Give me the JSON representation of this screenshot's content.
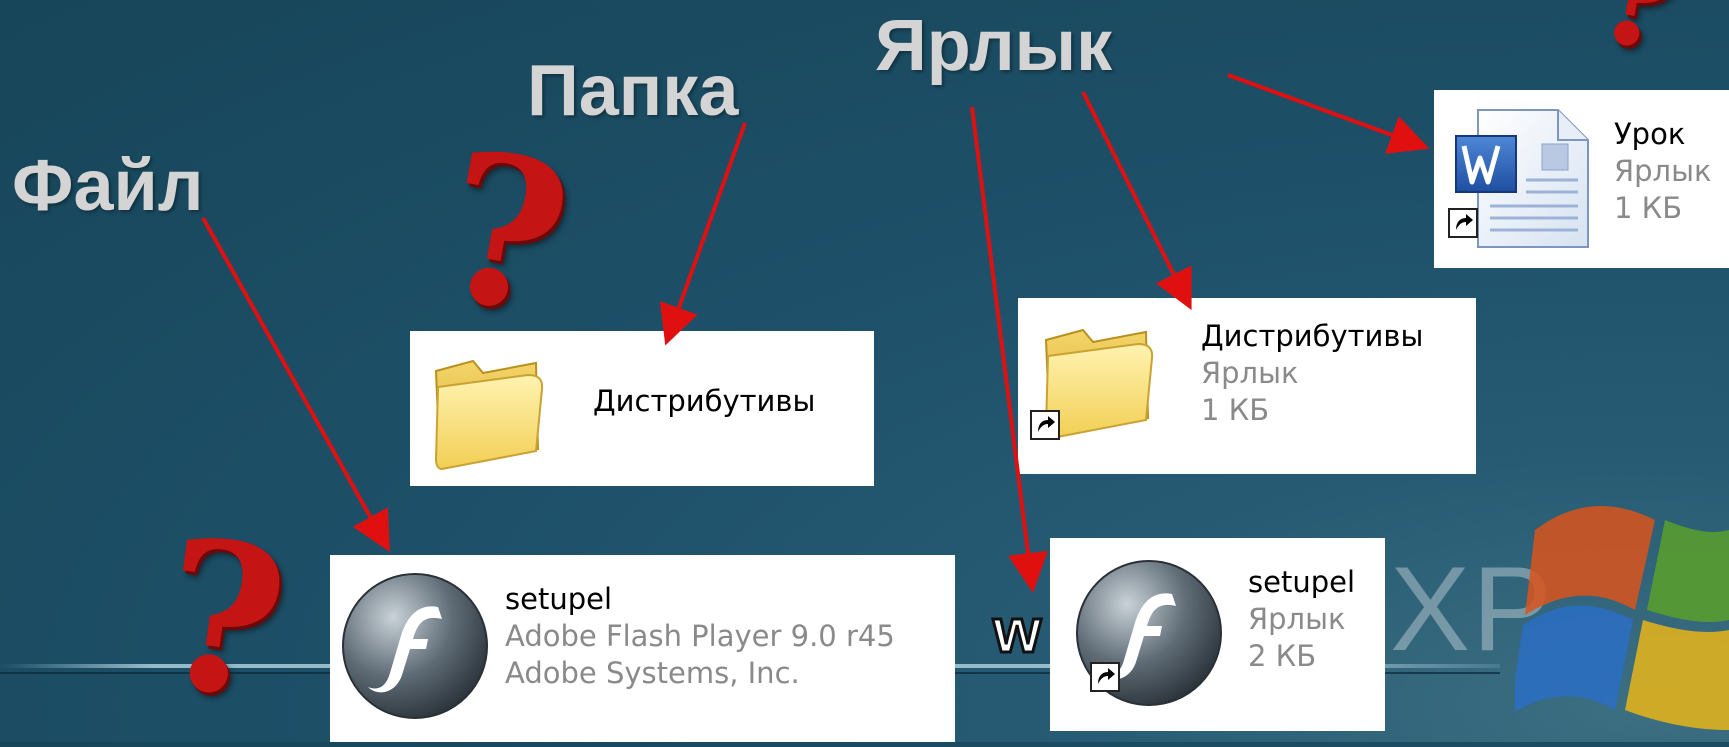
{
  "labels": {
    "file": "Файл",
    "folder": "Папка",
    "shortcut": "Ярлык"
  },
  "question_mark": "?",
  "xp_fragment": {
    "w": "w",
    "xp": "XP"
  },
  "panels": {
    "folder": {
      "name": "Дистрибутивы"
    },
    "file": {
      "name": "setupel",
      "description": "Adobe Flash Player 9.0  r45",
      "company": "Adobe Systems, Inc."
    },
    "folder_shortcut": {
      "name": "Дистрибутивы",
      "type": "Ярлык",
      "size": "1 КБ"
    },
    "file_shortcut": {
      "name": "setupel",
      "type": "Ярлык",
      "size": "2 КБ"
    },
    "doc_shortcut": {
      "name": "Урок",
      "type": "Ярлык",
      "size": "1 КБ"
    }
  },
  "colors": {
    "background": "#1d5068",
    "arrow": "#e01010",
    "question_mark": "#c41414",
    "label": "#d4d4d4"
  },
  "icons": [
    "folder-icon",
    "flash-icon",
    "word-document-icon",
    "shortcut-arrow-icon",
    "windows-logo-icon"
  ]
}
